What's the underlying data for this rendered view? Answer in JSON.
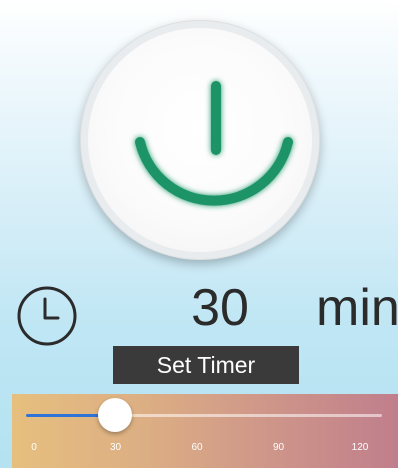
{
  "power_button": {
    "icon": "power-icon",
    "color": "#1e9467"
  },
  "timer": {
    "icon": "clock-icon",
    "value": "30",
    "unit": "min",
    "set_label": "Set Timer"
  },
  "slider": {
    "min": 0,
    "max": 120,
    "value": 30,
    "fill_color": "#2f73d6",
    "tick_labels": [
      "0",
      "30",
      "60",
      "90",
      "120"
    ]
  }
}
